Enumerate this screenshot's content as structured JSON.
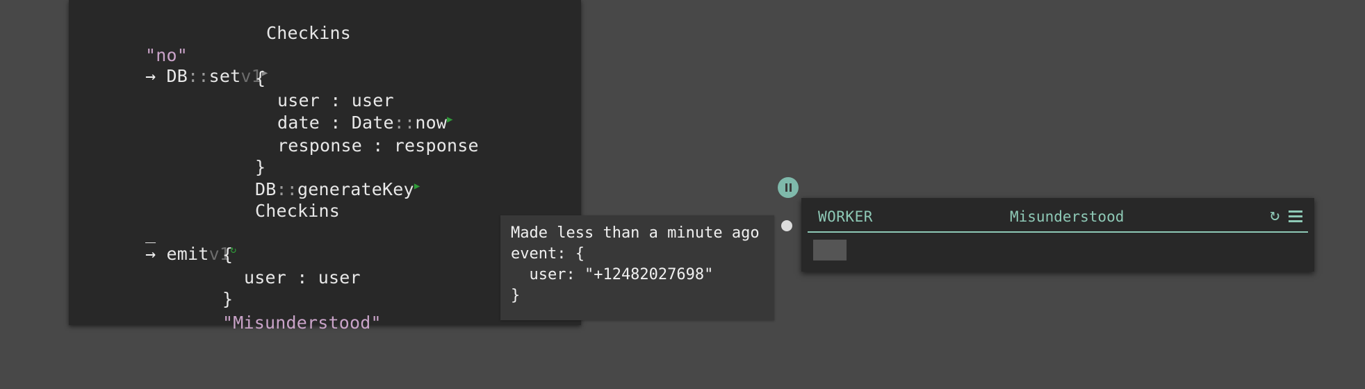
{
  "code": {
    "line1": {
      "text": "Checkins"
    },
    "line2": {
      "str": "\"no\"",
      "arrow": "→",
      "ns": "DB",
      "sep": "::",
      "fn": "set",
      "ver": "v1"
    },
    "line3": {
      "text": "{"
    },
    "line4": {
      "text": "user : user"
    },
    "line5": {
      "pre": "date : ",
      "ns": "Date",
      "sep": "::",
      "fn": "now"
    },
    "line6": {
      "text": "response : response"
    },
    "line7": {
      "text": "}"
    },
    "line8": {
      "ns": "DB",
      "sep": "::",
      "fn": "generateKey"
    },
    "line9": {
      "text": "Checkins"
    },
    "line10": {
      "wild": "_",
      "arrow": "→",
      "fn": "emit",
      "ver": "v1"
    },
    "line11": {
      "text": "{"
    },
    "line12": {
      "text": "user : user"
    },
    "line13": {
      "text": "}"
    },
    "line14": {
      "str": "\"Misunderstood\""
    }
  },
  "tooltip": {
    "line1": "Made less than a minute ago",
    "line2": "event: {",
    "line3": "  user: \"+12482027698\"",
    "line4": "}"
  },
  "worker": {
    "title": "WORKER",
    "name": "Misunderstood"
  },
  "colors": {
    "background": "#484848",
    "panel": "#282828",
    "accent": "#8ec9b6",
    "string": "#c9a3c8",
    "play_green": "#2f9a39"
  },
  "icons": {
    "play": "play-icon",
    "refresh": "refresh-icon",
    "menu": "hamburger-menu-icon",
    "pause": "pause-icon"
  }
}
